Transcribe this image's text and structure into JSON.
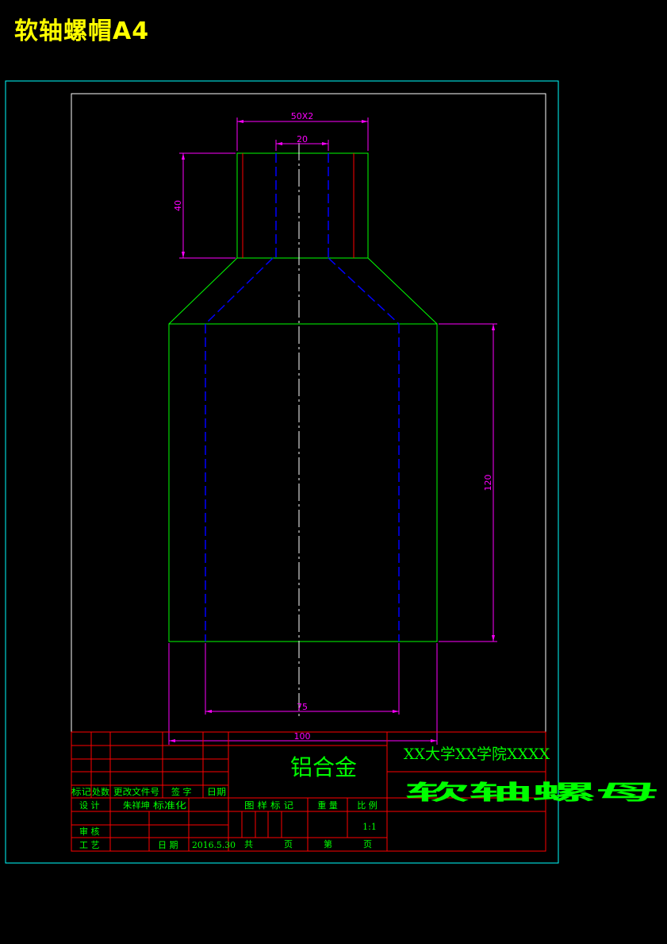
{
  "page_title": "软轴螺帽A4",
  "dimensions": {
    "top_width": "50X2",
    "bore_width": "20",
    "neck_height": "40",
    "body_height": "120",
    "inner_width": "75",
    "outer_width": "100"
  },
  "title_block": {
    "material": "铝合金",
    "school": "XX大学XX学院XXXX",
    "part_name": "软轴螺母",
    "revision_header": [
      "标记",
      "处数",
      "更改文件号",
      "签 字",
      "日期"
    ],
    "design_label": "设 计",
    "designer": "朱祥坤",
    "standardization": "标准化",
    "review_label": "审 核",
    "process_label": "工 艺",
    "date_label": "日 期",
    "date": "2016.5.30",
    "stage_label": "图 样 标 记",
    "weight_label": "重 量",
    "scale_label": "比 例",
    "scale": "1:1",
    "total_label": "共",
    "sheet_label": "页",
    "page_label": "第",
    "page_suffix": "页"
  },
  "colors": {
    "outline": "#00ff00",
    "hidden": "#0000ff",
    "dimension": "#ff00ff",
    "frame_outer": "#00ffff",
    "frame_inner": "#ffffff",
    "table": "#ff0000",
    "center": "#ffffff",
    "title": "#ffff00"
  }
}
